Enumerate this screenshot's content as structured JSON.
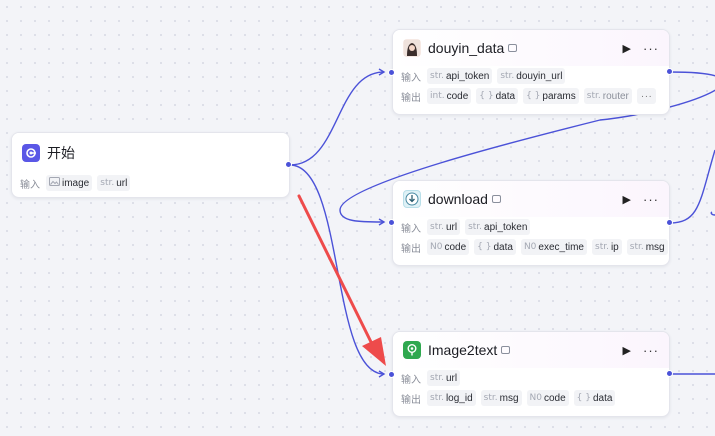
{
  "labels": {
    "input": "输入",
    "output": "输出"
  },
  "colors": {
    "wire": "#4b52d8",
    "arrow": "#ee4b4b",
    "start_icon": "#5a57e6"
  },
  "start": {
    "title": "开始",
    "icon": "start-icon",
    "inputs": [
      {
        "type_icon": "image-icon",
        "name": "image"
      },
      {
        "type": "str.",
        "name": "url"
      }
    ]
  },
  "douyin": {
    "title": "douyin_data",
    "icon": "avatar-girl-icon",
    "inputs": [
      {
        "type": "str.",
        "name": "api_token"
      },
      {
        "type": "str.",
        "name": "douyin_url"
      }
    ],
    "outputs": [
      {
        "type": "int.",
        "name": "code"
      },
      {
        "type": "{ }",
        "name": "data"
      },
      {
        "type": "{ }",
        "name": "params"
      },
      {
        "type": "str.",
        "name": "router"
      }
    ],
    "more_outputs": "···"
  },
  "download": {
    "title": "download",
    "icon": "download-plugin-icon",
    "inputs": [
      {
        "type": "str.",
        "name": "url"
      },
      {
        "type": "str.",
        "name": "api_token"
      }
    ],
    "outputs": [
      {
        "type": "N0",
        "name": "code"
      },
      {
        "type": "{ }",
        "name": "data"
      },
      {
        "type": "N0",
        "name": "exec_time"
      },
      {
        "type": "str.",
        "name": "ip"
      },
      {
        "type": "str.",
        "name": "msg"
      }
    ]
  },
  "image2text": {
    "title": "Image2text",
    "icon": "bulb-plugin-icon",
    "inputs": [
      {
        "type": "str.",
        "name": "url"
      }
    ],
    "outputs": [
      {
        "type": "str.",
        "name": "log_id"
      },
      {
        "type": "str.",
        "name": "msg"
      },
      {
        "type": "N0",
        "name": "code"
      },
      {
        "type": "{ }",
        "name": "data"
      }
    ]
  }
}
